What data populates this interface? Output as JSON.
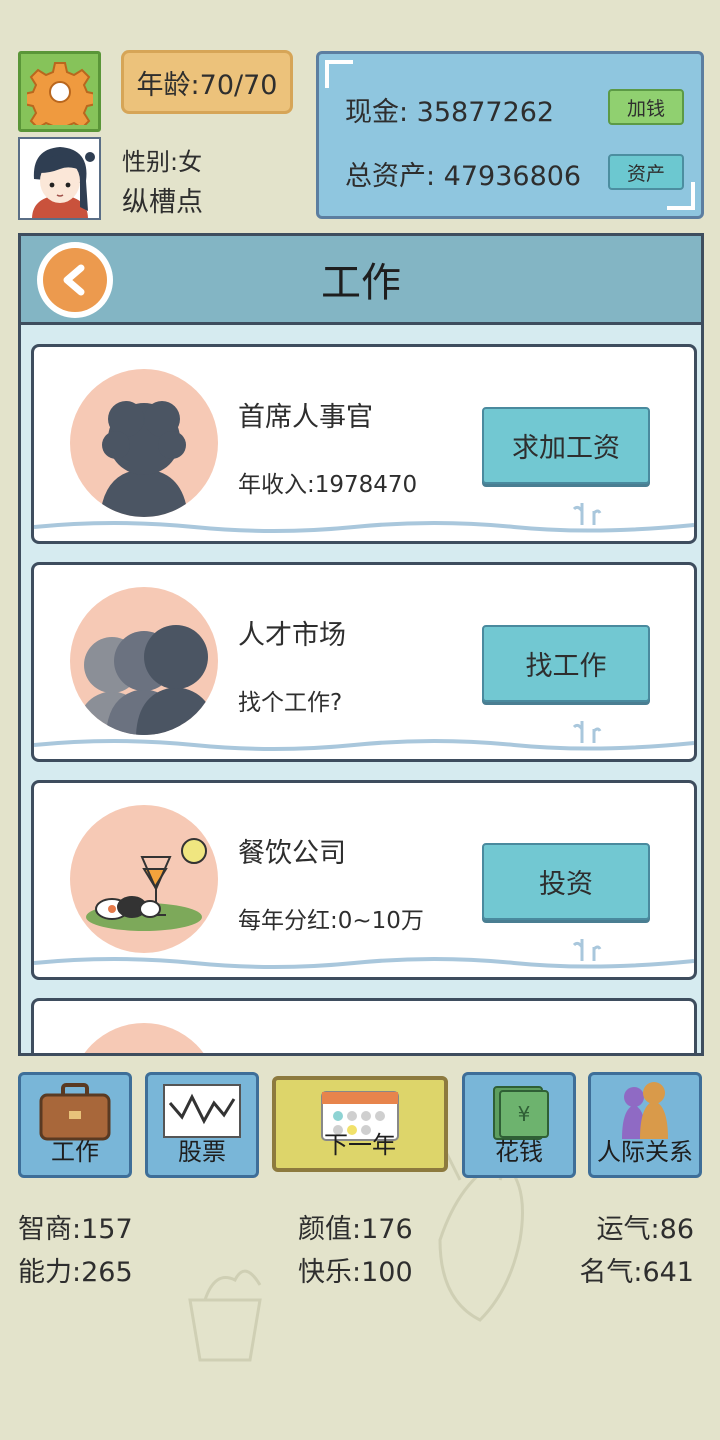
{
  "header": {
    "age_label": "年龄:70/70",
    "gender_label": "性别:女",
    "nickname": "纵槽点",
    "settings_icon": "gear-icon",
    "avatar_icon": "girl-avatar"
  },
  "money": {
    "cash_label": "现金: 35877262",
    "total_label": "总资产: 47936806",
    "add_money_button": "加钱",
    "assets_button": "资产"
  },
  "work_panel": {
    "title": "工作",
    "back_icon": "chevron-left-icon",
    "jobs": [
      {
        "title": "首席人事官",
        "subtitle": "年收入:1978470",
        "button": "求加工资",
        "icon": "person-silhouette"
      },
      {
        "title": "人才市场",
        "subtitle": "找个工作?",
        "button": "找工作",
        "icon": "people-silhouettes"
      },
      {
        "title": "餐饮公司",
        "subtitle": "每年分红:0~10万",
        "button": "投资",
        "icon": "cocktail-sushi"
      }
    ]
  },
  "nav": {
    "work": "工作",
    "stocks": "股票",
    "next_year": "下一年",
    "spend": "花钱",
    "relations": "人际关系"
  },
  "stats": {
    "iq": "智商:157",
    "looks": "颜值:176",
    "luck": "运气:86",
    "ability": "能力:265",
    "happiness": "快乐:100",
    "fame": "名气:641"
  },
  "colors": {
    "background": "#e3e3cb",
    "panel_blue": "#8fc6df",
    "card_button": "#72c8d2",
    "age_box": "#ecc27b",
    "settings_green": "#86c35a",
    "next_year": "#ddd56a"
  }
}
